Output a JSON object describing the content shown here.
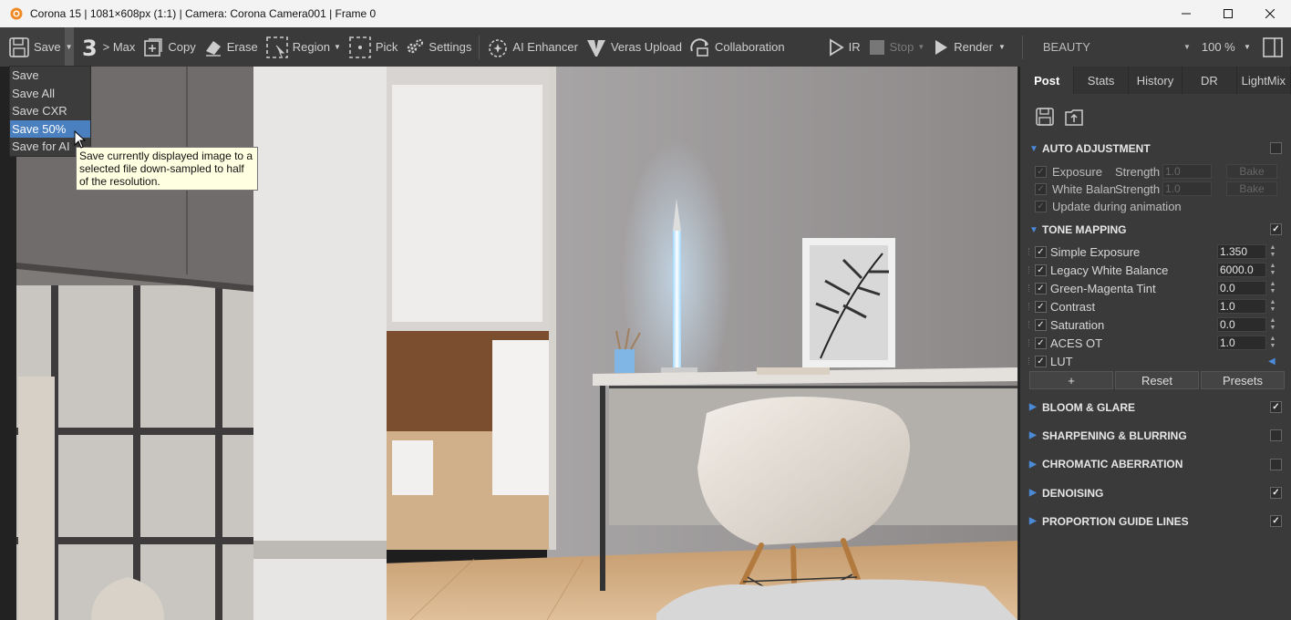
{
  "window": {
    "title": "Corona 15 | 1081×608px (1:1) | Camera: Corona Camera001 | Frame 0"
  },
  "toolbar": {
    "save_label": "Save",
    "max_label": "> Max",
    "copy_label": "Copy",
    "erase_label": "Erase",
    "region_label": "Region",
    "pick_label": "Pick",
    "settings_label": "Settings",
    "ai_enhancer_label": "AI Enhancer",
    "veras_label": "Veras Upload",
    "collab_label": "Collaboration",
    "ir_label": "IR",
    "stop_label": "Stop",
    "render_label": "Render",
    "channel": "BEAUTY",
    "zoom": "100 %"
  },
  "save_menu": {
    "items": [
      "Save",
      "Save All",
      "Save CXR",
      "Save 50%",
      "Save for AI"
    ],
    "active_index": 3,
    "tooltip": "Save currently displayed image to a selected file down-sampled to half of the resolution."
  },
  "panel": {
    "tabs": [
      "Post",
      "Stats",
      "History",
      "DR",
      "LightMix"
    ],
    "active_tab": "Post",
    "auto_adjustment": {
      "title": "AUTO ADJUSTMENT",
      "rows": [
        {
          "label": "Exposure",
          "strength": "Strength",
          "value": "1.0",
          "button": "Bake"
        },
        {
          "label": "White Balan",
          "strength": "Strength",
          "value": "1.0",
          "button": "Bake"
        }
      ],
      "update_label": "Update during animation"
    },
    "tone_mapping": {
      "title": "TONE MAPPING",
      "rows": [
        {
          "label": "Simple Exposure",
          "value": "1.350"
        },
        {
          "label": "Legacy White Balance",
          "value": "6000.0"
        },
        {
          "label": "Green-Magenta Tint",
          "value": "0.0"
        },
        {
          "label": "Contrast",
          "value": "1.0"
        },
        {
          "label": "Saturation",
          "value": "0.0"
        },
        {
          "label": "ACES OT",
          "value": "1.0"
        }
      ],
      "lut_label": "LUT",
      "buttons": [
        "+",
        "Reset",
        "Presets"
      ]
    },
    "sections": [
      {
        "title": "BLOOM & GLARE",
        "checked": true
      },
      {
        "title": "SHARPENING & BLURRING",
        "checked": false
      },
      {
        "title": "CHROMATIC ABERRATION",
        "checked": false
      },
      {
        "title": "DENOISING",
        "checked": true
      },
      {
        "title": "PROPORTION GUIDE LINES",
        "checked": true
      }
    ]
  },
  "colors": {
    "accent": "#4a7fc0",
    "toolbar_bg": "#3a3a3a",
    "panel_bg": "#3a3a3a",
    "tooltip_bg": "#ffffe1"
  }
}
